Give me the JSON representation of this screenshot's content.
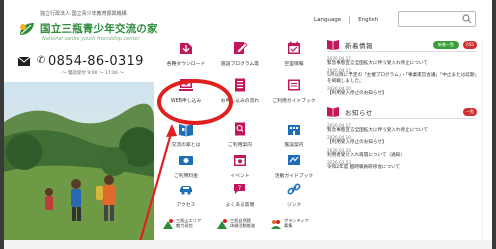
{
  "header": {
    "org_small": "独立行政法人 国立青少年教育振興機構",
    "site_title": "国立三瓶青少年交流の家",
    "site_subtitle": "National sanbe youth friendship center",
    "phone": "0854-86-0319",
    "phone_hours": "〜 電話受付 9:00 〜 17:00 〜",
    "lang_japanese": "Language",
    "lang_english": "English"
  },
  "menu": {
    "items": [
      {
        "label": "各種ダウンロード",
        "icon": "download-icon"
      },
      {
        "label": "施設プログラム等",
        "icon": "pen-paper-icon"
      },
      {
        "label": "空室情報",
        "icon": "calendar-icon"
      },
      {
        "label": "WEB申し込み",
        "icon": "web-application-icon"
      },
      {
        "label": "お申し込みの流れ",
        "icon": "flow-document-icon"
      },
      {
        "label": "ご利用ガイドブック",
        "icon": "guidebook-icon"
      },
      {
        "label": "交流の家とは",
        "icon": "house-book-icon"
      },
      {
        "label": "ご利用案内",
        "icon": "search-document-icon"
      },
      {
        "label": "施設案内",
        "icon": "building-icon"
      },
      {
        "label": "ご利用料金",
        "icon": "fee-icon"
      },
      {
        "label": "イベント",
        "icon": "event-calendar-icon"
      },
      {
        "label": "活動ガイドブック",
        "icon": "activity-book-icon"
      },
      {
        "label": "アクセス",
        "icon": "car-icon"
      },
      {
        "label": "よくある質問",
        "icon": "faq-icon"
      },
      {
        "label": "リンク",
        "icon": "link-icon"
      }
    ]
  },
  "partners": [
    {
      "line1": "三瓶山エリア",
      "line2": "魅力発信"
    },
    {
      "line1": "三瓶自然館",
      "line2": "体験活動推進"
    },
    {
      "line1": "ボランティア",
      "line2": "募集"
    }
  ],
  "news": {
    "title": "新着情報",
    "more_label": "新着一覧",
    "rss_label": "RSS",
    "entries": [
      {
        "date": "2020.04.17",
        "text": "緊急事態宣言全国拡大に伴う受入れ停止について"
      },
      {
        "date": "2020.04.17",
        "text": "5月以降に予定の「主催プログラム」・「事業運営会議」「中止または延期」を掲載しました。"
      },
      {
        "date": "2020.04.10",
        "text": "【利用受入停止のお知らせ】"
      }
    ]
  },
  "notice": {
    "title": "お知らせ",
    "rss_label": "一覧",
    "entries": [
      {
        "date": "2020.04.17",
        "text": "緊急事態宣言全国拡大に伴う受入れ停止について"
      },
      {
        "date": "2020.04.10",
        "text": "【利用受入停止のお知らせ】"
      },
      {
        "date": "2020.03.24",
        "text": "利用者受け入れ再開について（通知）"
      },
      {
        "date": "2020.03.23",
        "text": "令和2年度 臨時職員研修会について"
      }
    ]
  },
  "colors": {
    "brand_green": "#2d8c3a",
    "highlight_red": "#e02020",
    "news_pill_green": "#3a9e3a",
    "notice_pill_red": "#d32f2f"
  }
}
